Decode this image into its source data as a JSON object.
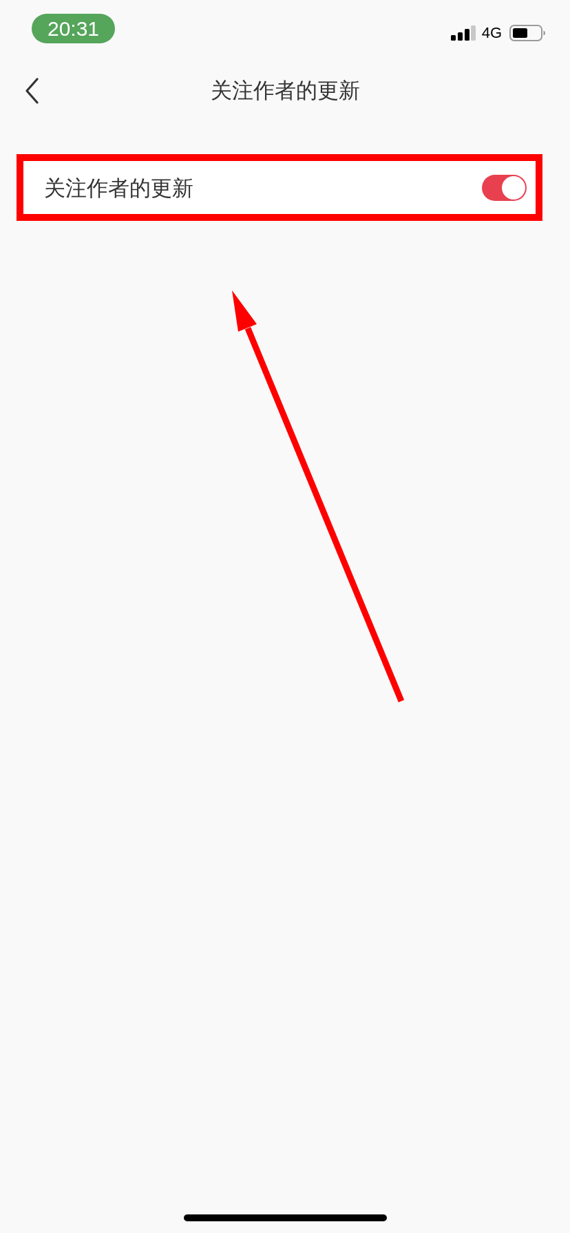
{
  "status_bar": {
    "time": "20:31",
    "network": "4G"
  },
  "nav_bar": {
    "title": "关注作者的更新"
  },
  "settings": [
    {
      "kind": "toggle",
      "label": "关注作者的更新",
      "on": true,
      "highlighted": true
    }
  ]
}
